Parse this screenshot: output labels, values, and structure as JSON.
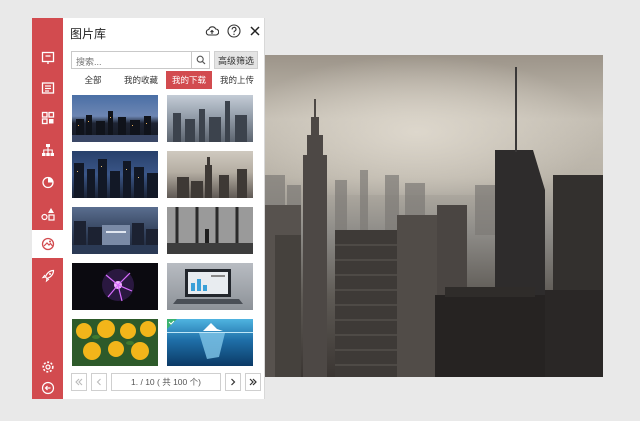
{
  "panel": {
    "title": "图片库",
    "search": {
      "placeholder": "搜索..."
    },
    "advanced_filter_label": "高级筛选",
    "tabs": [
      {
        "label": "全部",
        "active": false
      },
      {
        "label": "我的收藏",
        "active": false
      },
      {
        "label": "我的下载",
        "active": true
      },
      {
        "label": "我的上传",
        "active": false
      }
    ],
    "pagination": {
      "info": "1. / 10 ( 共 100 个)"
    }
  },
  "sidebar": {
    "items": [
      {
        "icon": "slide-icon"
      },
      {
        "icon": "text-box-icon"
      },
      {
        "icon": "layout-grid-icon"
      },
      {
        "icon": "org-chart-icon"
      },
      {
        "icon": "pie-chart-icon"
      },
      {
        "icon": "shapes-icon"
      },
      {
        "icon": "picture-icon",
        "active": true
      },
      {
        "icon": "rocket-icon"
      },
      {
        "icon": "gear-icon"
      },
      {
        "icon": "back-icon"
      }
    ]
  },
  "thumbnails": [
    {
      "icon": "city-skyline-night-image"
    },
    {
      "icon": "city-aerial-image"
    },
    {
      "icon": "city-dusk-image"
    },
    {
      "icon": "empire-state-image"
    },
    {
      "icon": "city-river-image"
    },
    {
      "icon": "office-window-image"
    },
    {
      "icon": "plasma-ball-image"
    },
    {
      "icon": "laptop-dashboard-image"
    },
    {
      "icon": "lemons-image"
    },
    {
      "icon": "iceberg-image"
    }
  ],
  "colors": {
    "accent": "#d24b4f",
    "panel_bg": "#ffffff",
    "page_bg": "#e9e9e9"
  }
}
